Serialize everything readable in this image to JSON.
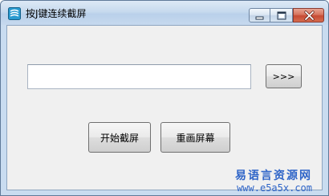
{
  "window": {
    "title": "按J键连续截屏"
  },
  "main": {
    "input_value": "",
    "go_button_label": ">>>",
    "start_button_label": "开始截屏",
    "reset_button_label": "重画屏幕"
  },
  "watermark": {
    "name": "易语言资源网",
    "url": "www.e5a5x.com"
  },
  "icons": {
    "app": "app-logo-icon",
    "minimize": "minimize-icon",
    "maximize": "maximize-icon",
    "close": "close-icon"
  },
  "colors": {
    "title_bar": "#c7daee",
    "client_bg": "#f0f0f0",
    "close_button": "#c64a33",
    "watermark": "#2f65c8"
  }
}
